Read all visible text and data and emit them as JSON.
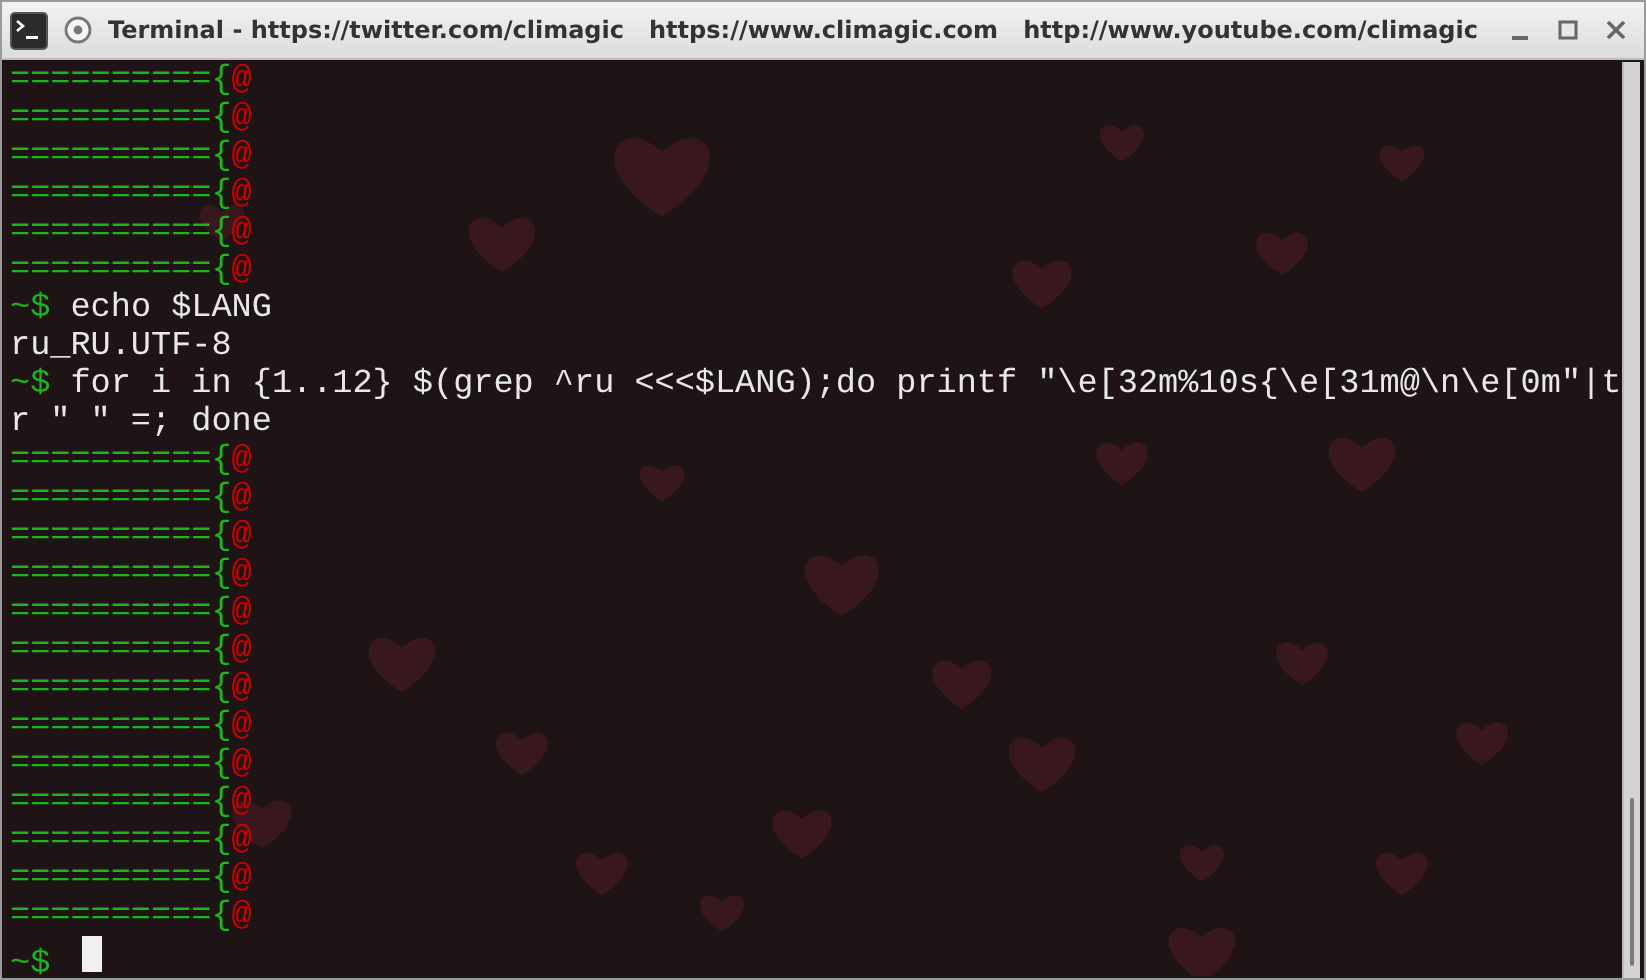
{
  "window": {
    "title": "Terminal - https://twitter.com/climagic   https://www.climagic.com   http://www.youtube.com/climagic"
  },
  "terminal": {
    "lines": [
      {
        "kind": "pattern",
        "equals": "==========",
        "brace": "{",
        "at": "@"
      },
      {
        "kind": "pattern",
        "equals": "==========",
        "brace": "{",
        "at": "@"
      },
      {
        "kind": "pattern",
        "equals": "==========",
        "brace": "{",
        "at": "@"
      },
      {
        "kind": "pattern",
        "equals": "==========",
        "brace": "{",
        "at": "@"
      },
      {
        "kind": "pattern",
        "equals": "==========",
        "brace": "{",
        "at": "@"
      },
      {
        "kind": "pattern",
        "equals": "==========",
        "brace": "{",
        "at": "@"
      },
      {
        "kind": "prompt",
        "prompt": "~$",
        "command": "echo $LANG"
      },
      {
        "kind": "plain",
        "text": "ru_RU.UTF-8"
      },
      {
        "kind": "prompt",
        "prompt": "~$",
        "command": "for i in {1..12} $(grep ^ru <<<$LANG);do printf \"\\e[32m%10s{\\e[31m@\\n\\e[0m\"|t"
      },
      {
        "kind": "plain",
        "text": "r \" \" =; done"
      },
      {
        "kind": "pattern",
        "equals": "==========",
        "brace": "{",
        "at": "@"
      },
      {
        "kind": "pattern",
        "equals": "==========",
        "brace": "{",
        "at": "@"
      },
      {
        "kind": "pattern",
        "equals": "==========",
        "brace": "{",
        "at": "@"
      },
      {
        "kind": "pattern",
        "equals": "==========",
        "brace": "{",
        "at": "@"
      },
      {
        "kind": "pattern",
        "equals": "==========",
        "brace": "{",
        "at": "@"
      },
      {
        "kind": "pattern",
        "equals": "==========",
        "brace": "{",
        "at": "@"
      },
      {
        "kind": "pattern",
        "equals": "==========",
        "brace": "{",
        "at": "@"
      },
      {
        "kind": "pattern",
        "equals": "==========",
        "brace": "{",
        "at": "@"
      },
      {
        "kind": "pattern",
        "equals": "==========",
        "brace": "{",
        "at": "@"
      },
      {
        "kind": "pattern",
        "equals": "==========",
        "brace": "{",
        "at": "@"
      },
      {
        "kind": "pattern",
        "equals": "==========",
        "brace": "{",
        "at": "@"
      },
      {
        "kind": "pattern",
        "equals": "==========",
        "brace": "{",
        "at": "@"
      },
      {
        "kind": "pattern",
        "equals": "==========",
        "brace": "{",
        "at": "@"
      },
      {
        "kind": "prompt",
        "prompt": "~$",
        "cursor": true
      }
    ]
  }
}
